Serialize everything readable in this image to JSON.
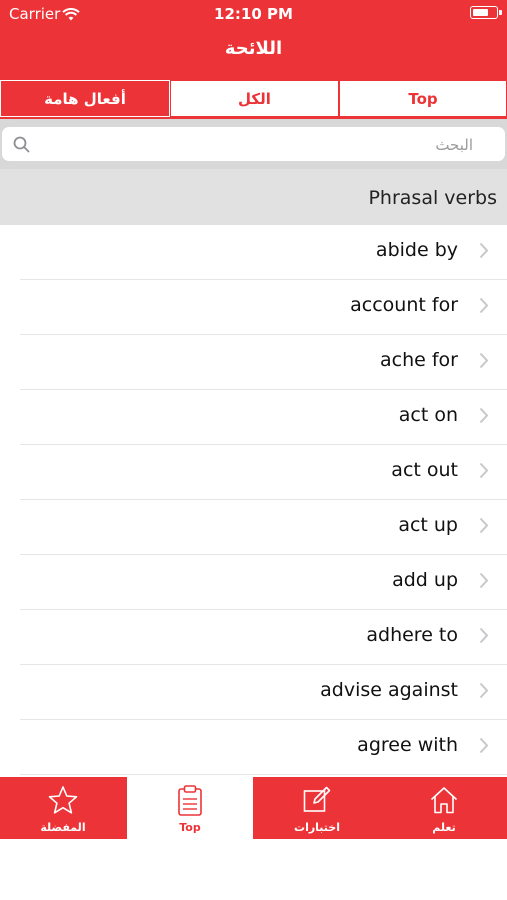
{
  "status": {
    "carrier": "Carrier",
    "time": "12:10 PM"
  },
  "nav": {
    "title": "اللائحة"
  },
  "segments": [
    {
      "label": "Top",
      "active": false
    },
    {
      "label": "الكل",
      "active": false
    },
    {
      "label": "أفعال هامة",
      "active": true
    }
  ],
  "search": {
    "placeholder": "البحث",
    "value": ""
  },
  "section": {
    "title": "Phrasal verbs"
  },
  "items": [
    "abide by",
    "account for",
    "ache for",
    "act on",
    "act out",
    "act up",
    "add up",
    "adhere to",
    "advise against",
    "agree with"
  ],
  "tabs": [
    {
      "label": "المفضلة",
      "icon": "star-icon",
      "active": false
    },
    {
      "label": "Top",
      "icon": "clipboard-icon",
      "active": true
    },
    {
      "label": "اختبارات",
      "icon": "edit-icon",
      "active": false
    },
    {
      "label": "تعلم",
      "icon": "home-icon",
      "active": false
    }
  ],
  "colors": {
    "accent": "#ec3338",
    "section_bg": "#e1e1e1",
    "search_bg": "#d8d8d8"
  }
}
